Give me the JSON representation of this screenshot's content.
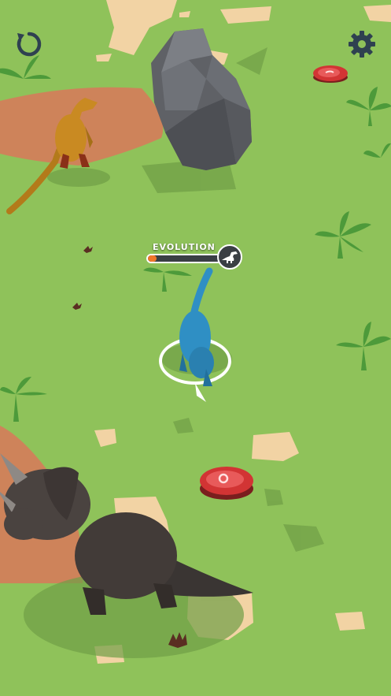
{
  "hud": {
    "restart_icon": "restart-icon",
    "settings_icon": "gear-icon"
  },
  "evolution": {
    "label": "EVOLUTION",
    "progress": 0.12,
    "target_icon": "t-rex-silhouette-icon"
  },
  "colors": {
    "grass": "#8fc25a",
    "sand": "#f2d3a4",
    "danger_zone": "#d9785a",
    "player_dino": "#2f8fc4",
    "evolution_fill": "#f0772a",
    "hud_icon": "#2f4150"
  }
}
